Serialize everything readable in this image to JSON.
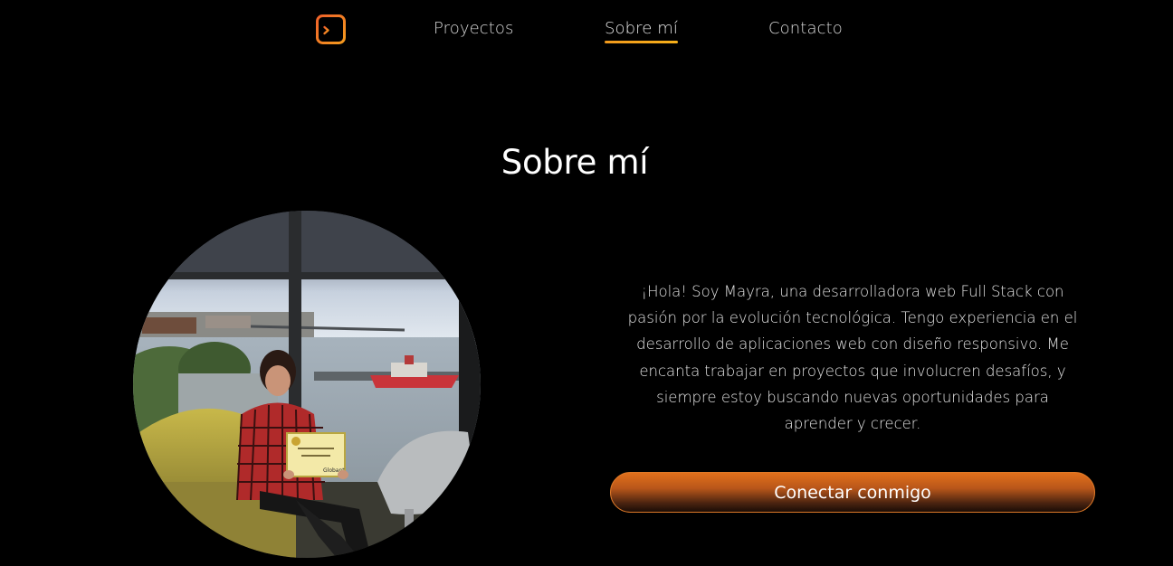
{
  "nav": {
    "logo_icon": "terminal-icon",
    "accent": "#f0622a",
    "links": [
      {
        "label": "Proyectos",
        "active": false
      },
      {
        "label": "Sobre mí",
        "active": true
      },
      {
        "label": "Contacto",
        "active": false
      }
    ]
  },
  "about": {
    "title": "Sobre mí",
    "bio": "¡Hola! Soy Mayra, una desarrolladora web Full Stack con pasión por la evolución tecnológica. Tengo experiencia en el desarrollo de aplicaciones web con diseño responsivo. Me encanta trabajar en proyectos que involucren desafíos, y siempre estoy buscando nuevas oportunidades para aprender y crecer.",
    "cta_label": "Conectar conmigo",
    "cta_color": "#e2701b"
  },
  "photo": {
    "certificate_label": "Globant"
  }
}
